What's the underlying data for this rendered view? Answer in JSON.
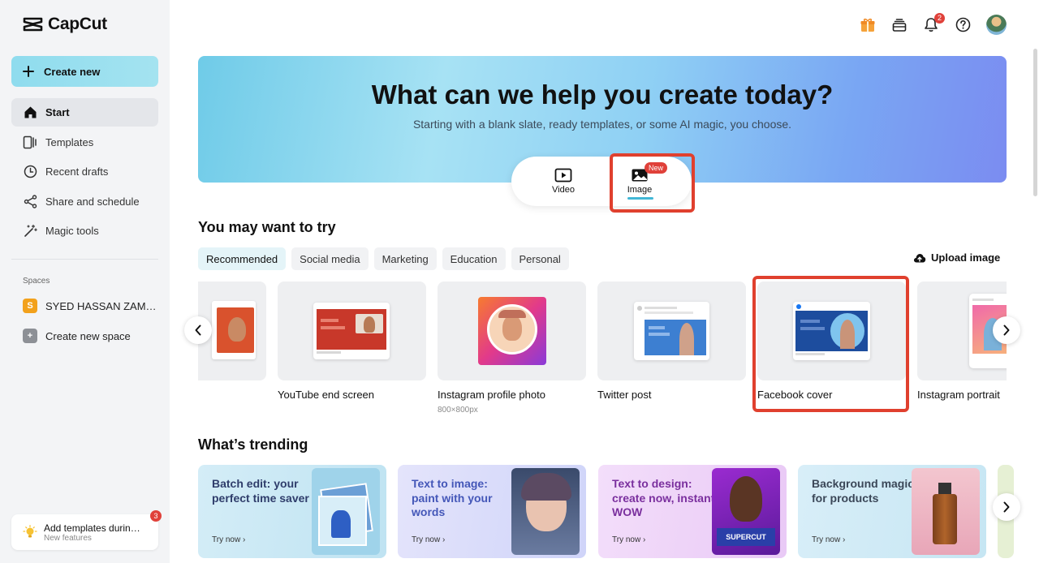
{
  "app": {
    "name": "CapCut"
  },
  "sidebar": {
    "create_label": "Create new",
    "items": [
      {
        "label": "Start",
        "icon": "home-icon",
        "active": true
      },
      {
        "label": "Templates",
        "icon": "templates-icon",
        "active": false
      },
      {
        "label": "Recent drafts",
        "icon": "clock-icon",
        "active": false
      },
      {
        "label": "Share and schedule",
        "icon": "share-icon",
        "active": false
      },
      {
        "label": "Magic tools",
        "icon": "magic-wand-icon",
        "active": false
      }
    ],
    "spaces_label": "Spaces",
    "space_name": "SYED HASSAN ZAM…",
    "space_initial": "S",
    "create_space_label": "Create new space",
    "notice": {
      "title": "Add templates durin…",
      "subtitle": "New features",
      "count": "3"
    }
  },
  "topbar": {
    "notification_count": "2"
  },
  "hero": {
    "title": "What can we help you create today?",
    "subtitle": "Starting with a blank slate, ready templates, or some AI magic, you choose.",
    "tabs": [
      {
        "label": "Video"
      },
      {
        "label": "Image",
        "badge": "New",
        "active": true
      }
    ]
  },
  "try_section": {
    "title": "You may want to try",
    "chips": [
      "Recommended",
      "Social media",
      "Marketing",
      "Education",
      "Personal"
    ],
    "upload_label": "Upload image",
    "templates": [
      {
        "label": "YouTube end screen"
      },
      {
        "label": "Instagram profile photo",
        "size": "800×800px"
      },
      {
        "label": "Twitter post"
      },
      {
        "label": "Facebook cover"
      },
      {
        "label": "Instagram portrait"
      }
    ]
  },
  "trending": {
    "title": "What’s trending",
    "try_label": "Try now ›",
    "cards": [
      {
        "title": "Batch edit: your perfect time saver",
        "color": "#2f3d6b"
      },
      {
        "title": "Text to image: paint with your words",
        "color": "#4457b8"
      },
      {
        "title": "Text to design: create now, instant WOW",
        "color": "#7a2f9e"
      },
      {
        "title": "Background magic for products",
        "color": "#3b4758"
      }
    ],
    "supercut_label": "SUPERCUT"
  }
}
